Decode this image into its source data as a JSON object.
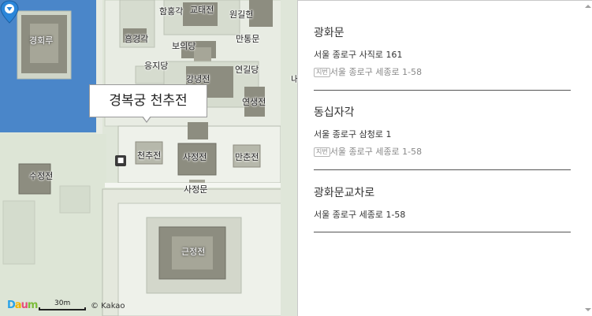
{
  "map": {
    "labels": {
      "gyeonghoeru": "경회루",
      "hamhongak": "함홍각",
      "gyotaejeon": "교태전",
      "wonguljeon": "원길헌",
      "heumgyeonggak": "흠경각",
      "boeuidang": "보의당",
      "mantongmun": "만통문",
      "eungjidang": "응지당",
      "gangnyeongjeon": "강녕전",
      "yeongildang": "연길당",
      "nae": "내",
      "yeonsaengjeon": "연생전",
      "sujeongjeon": "수정전",
      "cheonchujeon": "천추전",
      "sajeongjeon": "사정전",
      "manchunjeon": "만춘전",
      "sajeongmun": "사정문",
      "geunjeongjeon": "근정전"
    },
    "infobox_title": "경복궁 천추전",
    "logo": {
      "d": "D",
      "a": "a",
      "u": "u",
      "m": "m"
    },
    "scale_label": "30m",
    "copyright": "© Kakao"
  },
  "results": [
    {
      "name": "광화문",
      "road_address": "서울 종로구 사직로 161",
      "jibun_badge": "지번",
      "jibun_address": "서울 종로구 세종로 1-58"
    },
    {
      "name": "동십자각",
      "road_address": "서울 종로구 삼청로 1",
      "jibun_badge": "지번",
      "jibun_address": "서울 종로구 세종로 1-58"
    },
    {
      "name": "광화문교차로",
      "road_address": "서울 종로구 세종로 1-58"
    }
  ],
  "colors": {
    "water": "#4a86c9",
    "ground": "#dfe6d9",
    "courtyard": "#eef1ea",
    "roof": "#8d8d80",
    "marker": "#2b86d9"
  }
}
